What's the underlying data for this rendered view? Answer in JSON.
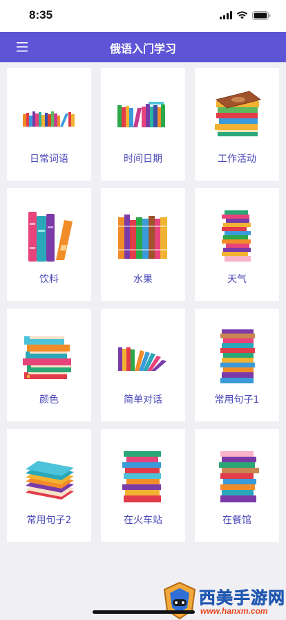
{
  "status_bar": {
    "time": "8:35",
    "icons": [
      "signal-icon",
      "wifi-icon",
      "battery-icon"
    ]
  },
  "nav": {
    "title": "俄语入门学习",
    "menu_icon": "hamburger-menu-icon",
    "color": "#5d54d6"
  },
  "categories": [
    {
      "label": "日常词语",
      "icon": "books-row-small-icon"
    },
    {
      "label": "时间日期",
      "icon": "books-row-icon"
    },
    {
      "label": "工作活动",
      "icon": "book-stack-icon"
    },
    {
      "label": "饮料",
      "icon": "tall-books-icon"
    },
    {
      "label": "水果",
      "icon": "books-upright-icon"
    },
    {
      "label": "天气",
      "icon": "thin-book-stack-icon"
    },
    {
      "label": "颜色",
      "icon": "book-stack-icon"
    },
    {
      "label": "简单对话",
      "icon": "leaning-books-icon"
    },
    {
      "label": "常用句子1",
      "icon": "tall-book-stack-icon"
    },
    {
      "label": "常用句子2",
      "icon": "book-stack-icon"
    },
    {
      "label": "在火车站",
      "icon": "tall-book-stack-icon"
    },
    {
      "label": "在餐馆",
      "icon": "book-stack-icon"
    }
  ],
  "label_color": "#4a47b8",
  "watermark": {
    "title": "西美手游网",
    "url": "www.hanxm.com"
  }
}
